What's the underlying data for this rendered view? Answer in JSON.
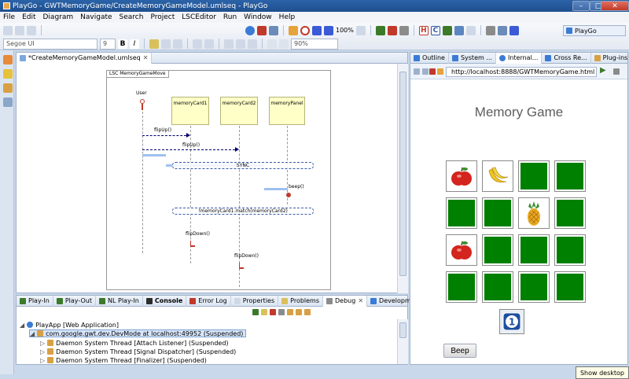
{
  "window": {
    "title": "PlayGo - GWTMemoryGame/CreateMemoryGameModel.umlseq - PlayGo"
  },
  "menu": [
    "File",
    "Edit",
    "Diagram",
    "Navigate",
    "Search",
    "Project",
    "LSCEditor",
    "Run",
    "Window",
    "Help"
  ],
  "toolbar": {
    "zoom": "100%",
    "font_name": "Segoe UI",
    "font_size": "9",
    "opacity": "90%",
    "perspective": "PlayGo"
  },
  "editor": {
    "tab_label": "*CreateMemoryGameModel.umlseq",
    "frame_label": "LSC MemoryGameMove",
    "lifelines": [
      "User",
      "memoryCard1",
      "memoryCard2",
      "memoryPanel"
    ],
    "messages": [
      "flipUp()",
      "flipUp()",
      "beep()",
      "flipDown()",
      "flipDown()"
    ],
    "conditions": [
      "SYNC",
      "!memoryCard1.match(memoryCard2)"
    ]
  },
  "bottom": {
    "tabs": [
      "Play-In",
      "Play-Out",
      "NL Play-In",
      "Console",
      "Error Log",
      "Properties",
      "Problems",
      "Debug",
      "Development Mode"
    ],
    "active_tab": "Debug",
    "tree": [
      "PlayApp [Web Application]",
      "com.google.gwt.dev.DevMode at localhost:49952 (Suspended)",
      "Daemon System Thread [Attach Listener] (Suspended)",
      "Daemon System Thread [Signal Dispatcher] (Suspended)",
      "Daemon System Thread [Finalizer] (Suspended)"
    ]
  },
  "right": {
    "tabs": [
      "Outline",
      "System ...",
      "Internal...",
      "Cross Re...",
      "Plug-ins"
    ],
    "url": "http://localhost:8888/GWTMemoryGame.html",
    "game_title": "Memory Game",
    "cards": [
      [
        "apple",
        "banana",
        "hidden",
        "hidden"
      ],
      [
        "hidden",
        "hidden",
        "pineapple",
        "hidden"
      ],
      [
        "apple",
        "hidden",
        "hidden",
        "hidden"
      ],
      [
        "hidden",
        "hidden",
        "hidden",
        "hidden"
      ]
    ],
    "counter_icon": "number-one-icon",
    "counter_value": "1",
    "beep_label": "Beep"
  },
  "taskbar": {
    "show_desktop": "Show desktop"
  }
}
